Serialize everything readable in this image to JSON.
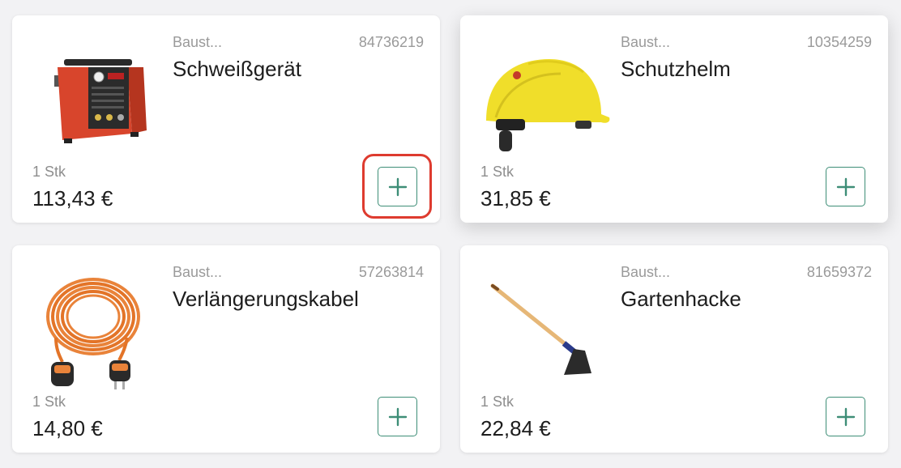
{
  "products": [
    {
      "supplier": "Baust...",
      "article_no": "84736219",
      "name": "Schweißgerät",
      "quantity": "1 Stk",
      "price": "113,43 €",
      "image": "welding-machine-icon"
    },
    {
      "supplier": "Baust...",
      "article_no": "10354259",
      "name": "Schutzhelm",
      "quantity": "1 Stk",
      "price": "31,85 €",
      "image": "safety-helmet-icon"
    },
    {
      "supplier": "Baust...",
      "article_no": "57263814",
      "name": "Verlängerungskabel",
      "quantity": "1 Stk",
      "price": "14,80 €",
      "image": "extension-cable-icon"
    },
    {
      "supplier": "Baust...",
      "article_no": "81659372",
      "name": "Gartenhacke",
      "quantity": "1 Stk",
      "price": "22,84 €",
      "image": "garden-hoe-icon"
    }
  ],
  "add_button_icon": "plus-icon",
  "colors": {
    "accent": "#3e8e77",
    "highlight": "#de3b2f",
    "background": "#f2f2f4"
  }
}
